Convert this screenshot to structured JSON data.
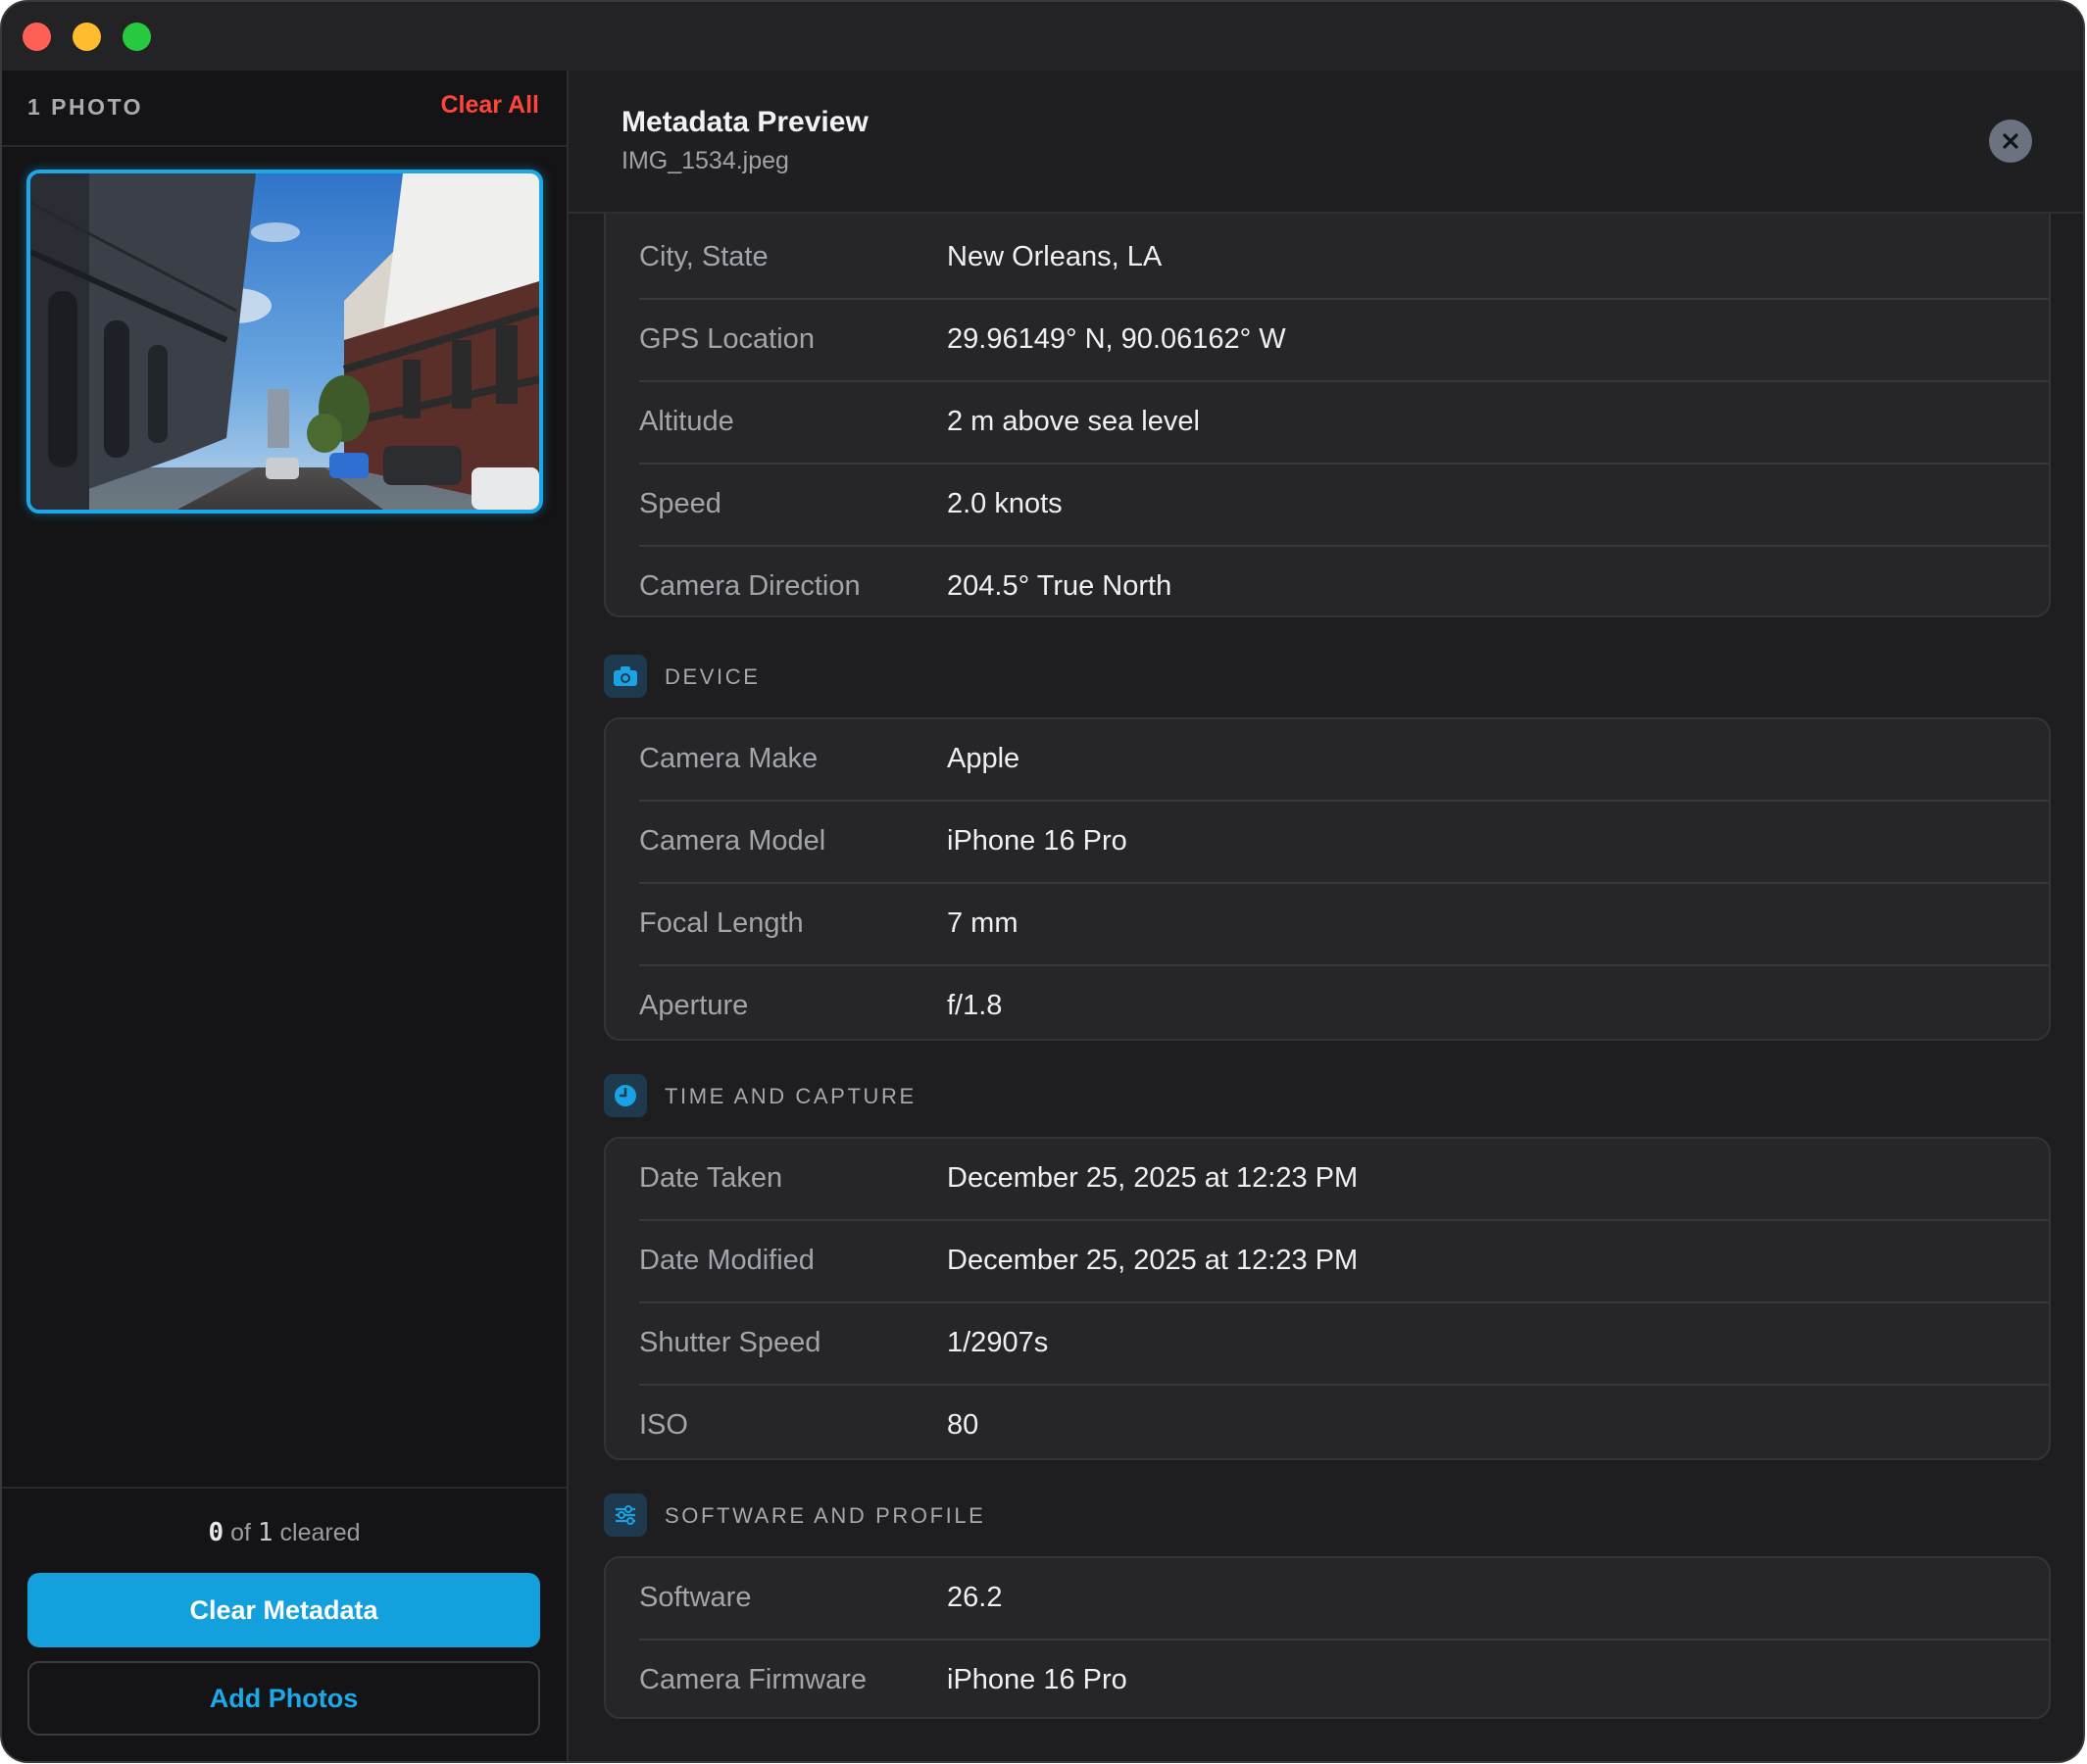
{
  "sidebar": {
    "photo_count_label": "1 PHOTO",
    "clear_all_label": "Clear All",
    "status": {
      "cleared": "0",
      "of_text": "of",
      "total": "1",
      "suffix": "cleared"
    },
    "clear_metadata_label": "Clear Metadata",
    "add_photos_label": "Add Photos"
  },
  "panel": {
    "title": "Metadata Preview",
    "filename": "IMG_1534.jpeg"
  },
  "location_rows": [
    {
      "label": "City, State",
      "value": "New Orleans, LA"
    },
    {
      "label": "GPS Location",
      "value": "29.96149° N, 90.06162° W"
    },
    {
      "label": "Altitude",
      "value": "2 m above sea level"
    },
    {
      "label": "Speed",
      "value": "2.0 knots"
    },
    {
      "label": "Camera Direction",
      "value": "204.5° True North"
    }
  ],
  "sections": {
    "device": {
      "title": "DEVICE",
      "icon": "camera-icon",
      "rows": [
        {
          "label": "Camera Make",
          "value": "Apple"
        },
        {
          "label": "Camera Model",
          "value": "iPhone 16 Pro"
        },
        {
          "label": "Focal Length",
          "value": "7 mm"
        },
        {
          "label": "Aperture",
          "value": "f/1.8"
        }
      ]
    },
    "time": {
      "title": "TIME AND CAPTURE",
      "icon": "clock-icon",
      "rows": [
        {
          "label": "Date Taken",
          "value": "December 25, 2025 at 12:23 PM"
        },
        {
          "label": "Date Modified",
          "value": "December 25, 2025 at 12:23 PM"
        },
        {
          "label": "Shutter Speed",
          "value": "1/2907s"
        },
        {
          "label": "ISO",
          "value": "80"
        }
      ]
    },
    "software": {
      "title": "SOFTWARE AND PROFILE",
      "icon": "sliders-icon",
      "rows": [
        {
          "label": "Software",
          "value": "26.2"
        },
        {
          "label": "Camera Firmware",
          "value": "iPhone 16 Pro"
        }
      ]
    }
  },
  "colors": {
    "accent": "#13a0dc",
    "destructive": "#ff453a",
    "window_bg": "#1e1e20",
    "sidebar_bg": "#141416",
    "card_bg": "#262628"
  }
}
